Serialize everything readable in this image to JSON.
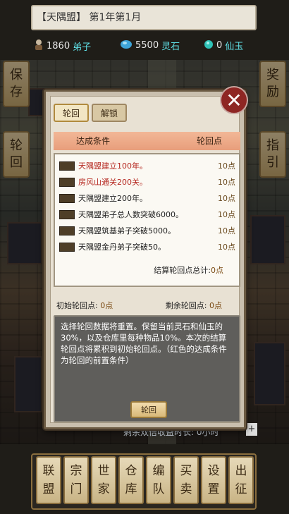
{
  "header": {
    "title": "【天隅盟】 第1年第1月",
    "resources": [
      {
        "icon": "disciple-icon",
        "value": "1860",
        "label": "弟子"
      },
      {
        "icon": "spirit-stone-icon",
        "value": "5500",
        "label": "灵石"
      },
      {
        "icon": "jade-icon",
        "value": "0",
        "label": "仙玉"
      }
    ]
  },
  "side": {
    "save": [
      "保",
      "存"
    ],
    "reincarnate": [
      "轮",
      "回"
    ],
    "reward": [
      "奖",
      "励"
    ],
    "guide": [
      "指",
      "引"
    ]
  },
  "panel": {
    "tabs": [
      "轮回",
      "解锁"
    ],
    "col_condition": "达成条件",
    "col_points": "轮回点",
    "conditions": [
      {
        "text": "天隅盟建立100年。",
        "points": "10点",
        "red": true
      },
      {
        "text": "房风山通关200关。",
        "points": "10点",
        "red": true
      },
      {
        "text": "天隅盟建立200年。",
        "points": "10点",
        "red": false
      },
      {
        "text": "天隅盟弟子总人数突破6000。",
        "points": "10点",
        "red": false
      },
      {
        "text": "天隅盟筑基弟子突破5000。",
        "points": "10点",
        "red": false
      },
      {
        "text": "天隅盟金丹弟子突破50。",
        "points": "10点",
        "red": false
      }
    ],
    "total_label": "结算轮回点总计:",
    "total_value": "0点",
    "initial_label": "初始轮回点:",
    "initial_value": "0点",
    "remaining_label": "剩余轮回点:",
    "remaining_value": "0点",
    "description": "选择轮回数据将重置。保留当前灵石和仙玉的30%，以及仓库里每种物品10%。本次的结算轮回点将累积到初始轮回点。（红色的达成条件为轮回的前置条件）",
    "button": "轮回"
  },
  "behind_text": "剩余双倍收益时长: 0小时",
  "bottom_nav": [
    [
      "联",
      "盟"
    ],
    [
      "宗",
      "门"
    ],
    [
      "世",
      "家"
    ],
    [
      "仓",
      "库"
    ],
    [
      "编",
      "队"
    ],
    [
      "买",
      "卖"
    ],
    [
      "设",
      "置"
    ],
    [
      "出",
      "征"
    ]
  ],
  "colors": {
    "accent_red": "#b5271f",
    "header_row": "#e89e7b",
    "close_button": "#8e2623"
  }
}
